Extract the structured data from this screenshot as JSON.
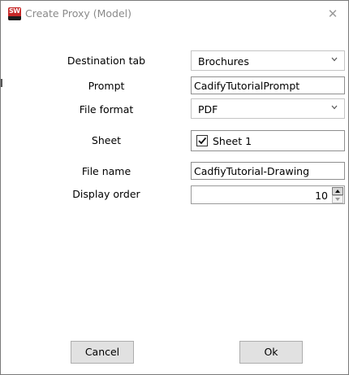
{
  "window": {
    "title": "Create Proxy (Model)",
    "close_glyph": "✕",
    "logo_icon": "solidworks-logo-icon",
    "logo_text": "SW"
  },
  "form": {
    "destination_tab": {
      "label": "Destination tab",
      "value": "Brochures"
    },
    "prompt": {
      "label": "Prompt",
      "value": "CadifyTutorialPrompt"
    },
    "file_format": {
      "label": "File format",
      "value": "PDF"
    },
    "sheet": {
      "label": "Sheet",
      "option_label": "Sheet 1",
      "checked": true
    },
    "file_name": {
      "label": "File name",
      "value": "CadfiyTutorial-Drawing"
    },
    "display_order": {
      "label": "Display order",
      "value": "10"
    }
  },
  "buttons": {
    "cancel": "Cancel",
    "ok": "Ok"
  },
  "colors": {
    "title_text": "#8a8a8a",
    "logo_red": "#c62828",
    "button_face": "#e1e1e1"
  }
}
